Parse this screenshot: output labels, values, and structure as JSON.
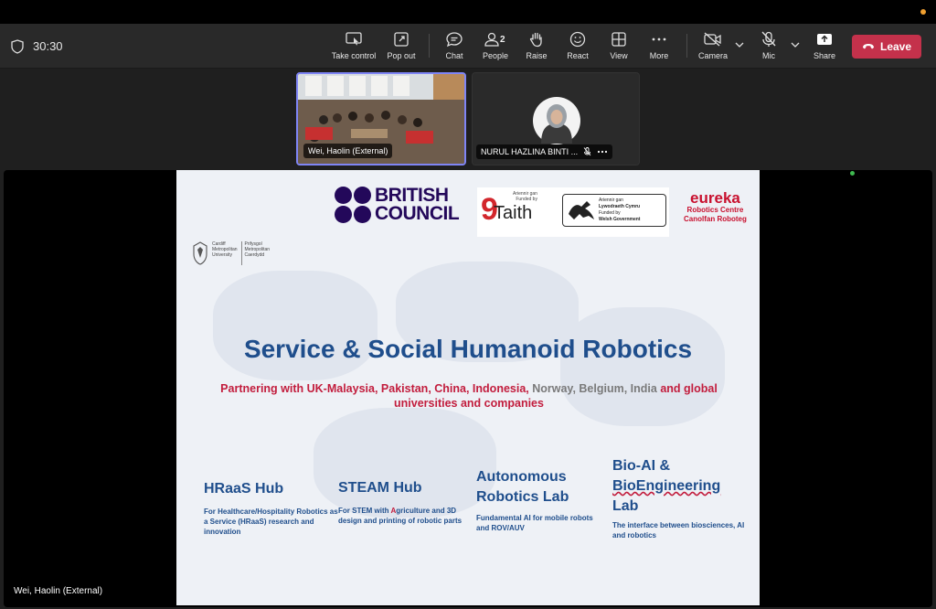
{
  "meeting": {
    "timer": "30:30",
    "toolbar": {
      "take_control": "Take control",
      "pop_out": "Pop out",
      "chat": "Chat",
      "people": "People",
      "people_count": "2",
      "raise": "Raise",
      "react": "React",
      "view": "View",
      "more": "More",
      "camera": "Camera",
      "mic": "Mic",
      "share": "Share",
      "leave": "Leave"
    },
    "participants": [
      {
        "name": "Wei, Haolin (External)"
      },
      {
        "name": "NURUL HAZLINA BINTI ..."
      }
    ],
    "main_label": "Wei, Haolin (External)"
  },
  "slide": {
    "logos": {
      "british_council_line1": "BRITISH",
      "british_council_line2": "COUNCIL",
      "taith_small_1": "Ariennir gan",
      "taith_small_2": "Funded by",
      "taith": "Taith",
      "welsh_1": "Ariennir gan",
      "welsh_2": "Lywodraeth Cymru",
      "welsh_3": "Funded by",
      "welsh_4": "Welsh Government",
      "eureka": "eureka",
      "eureka_2": "Robotics Centre",
      "eureka_3": "Canolfan Roboteg",
      "cardiff_1": "Cardiff",
      "cardiff_2": "Metropolitan",
      "cardiff_3": "University",
      "cardiff_4": "Prifysgol",
      "cardiff_5": "Metropolitan",
      "cardiff_6": "Caerdydd"
    },
    "title": "Service & Social Humanoid Robotics",
    "subtitle_a": "Partnering with UK-Malaysia, Pakistan, China, Indonesia, ",
    "subtitle_b": "Norway, Belgium, India",
    "subtitle_c": " and global universities and companies",
    "hubs": [
      {
        "title": "HRaaS Hub",
        "desc": "For Healthcare/Hospitality Robotics as a Service (HRaaS) research and innovation"
      },
      {
        "title": "STEAM Hub",
        "desc_a": "For STEM with ",
        "desc_b": "A",
        "desc_c": "griculture and 3D design and printing of robotic parts"
      },
      {
        "title_1": "Autonomous",
        "title_2": "Robotics Lab",
        "desc": "Fundamental AI for mobile robots and ROV/AUV"
      },
      {
        "title_1": "Bio-AI &",
        "title_2": "BioEngineering",
        "title_3": "Lab",
        "desc": "The interface between biosciences, AI and robotics"
      }
    ]
  },
  "colors": {
    "toolbar": "#292929",
    "leave": "#c4314b",
    "active_tile_border": "#7f85f5",
    "slide_blue": "#1f4e8c",
    "slide_red": "#c21d3d"
  }
}
